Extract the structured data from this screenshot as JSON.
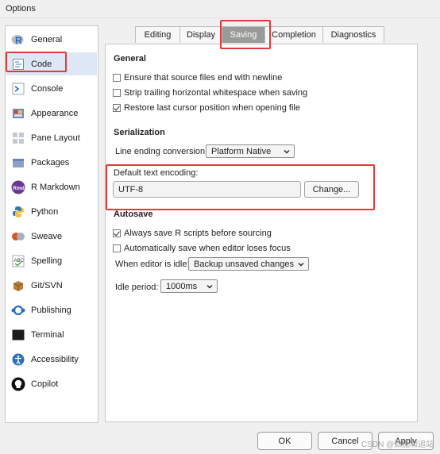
{
  "window": {
    "title": "Options"
  },
  "sidebar": {
    "items": [
      {
        "label": "General",
        "icon": "r-logo-icon"
      },
      {
        "label": "Code",
        "icon": "code-icon"
      },
      {
        "label": "Console",
        "icon": "console-icon"
      },
      {
        "label": "Appearance",
        "icon": "appearance-icon"
      },
      {
        "label": "Pane Layout",
        "icon": "pane-layout-icon"
      },
      {
        "label": "Packages",
        "icon": "packages-icon"
      },
      {
        "label": "R Markdown",
        "icon": "rmd-icon"
      },
      {
        "label": "Python",
        "icon": "python-icon"
      },
      {
        "label": "Sweave",
        "icon": "sweave-icon"
      },
      {
        "label": "Spelling",
        "icon": "spelling-icon"
      },
      {
        "label": "Git/SVN",
        "icon": "git-icon"
      },
      {
        "label": "Publishing",
        "icon": "publishing-icon"
      },
      {
        "label": "Terminal",
        "icon": "terminal-icon"
      },
      {
        "label": "Accessibility",
        "icon": "accessibility-icon"
      },
      {
        "label": "Copilot",
        "icon": "copilot-icon"
      }
    ],
    "selected": "Code"
  },
  "tabs": [
    {
      "label": "Editing"
    },
    {
      "label": "Display"
    },
    {
      "label": "Saving"
    },
    {
      "label": "Completion"
    },
    {
      "label": "Diagnostics"
    }
  ],
  "active_tab": "Saving",
  "general": {
    "heading": "General",
    "options": [
      {
        "label": "Ensure that source files end with newline",
        "checked": false
      },
      {
        "label": "Strip trailing horizontal whitespace when saving",
        "checked": false
      },
      {
        "label": "Restore last cursor position when opening file",
        "checked": true
      }
    ]
  },
  "serialization": {
    "heading": "Serialization",
    "line_ending_label": "Line ending conversion:",
    "line_ending_value": "Platform Native",
    "encoding_label": "Default text encoding:",
    "encoding_value": "UTF-8",
    "change_button": "Change..."
  },
  "autosave": {
    "heading": "Autosave",
    "options": [
      {
        "label": "Always save R scripts before sourcing",
        "checked": true
      },
      {
        "label": "Automatically save when editor loses focus",
        "checked": false
      }
    ],
    "idle_label": "When editor is idle:",
    "idle_value": "Backup unsaved changes",
    "period_label": "Idle period:",
    "period_value": "1000ms"
  },
  "footer": {
    "ok": "OK",
    "cancel": "Cancel",
    "apply": "Apply"
  },
  "watermark": "CSDN @数据和追站",
  "colors": {
    "highlight": "#e03b3b",
    "selected_bg": "#dde7f5",
    "active_tab_bg": "#9a9a9a"
  }
}
